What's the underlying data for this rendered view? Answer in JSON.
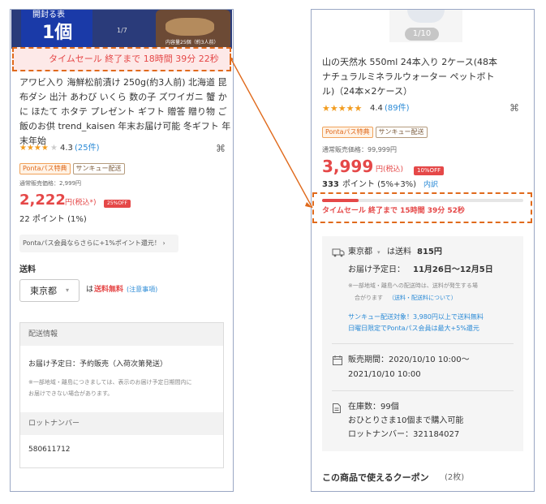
{
  "left": {
    "hero": {
      "badge_top": "開封る表",
      "badge_main": "1個",
      "counter": "1/7",
      "caption": "内容量25個（約3人前）"
    },
    "timesale": "タイムセール 終了まで 18時間 39分 22秒",
    "title_lines": [
      "アワビ入り 海鮮松前漬け 250g(約3人前) 北海道 昆",
      "布ダシ 出汁 あわび いくら 数の子 ズワイガニ 蟹 か",
      "に ほたて ホタテ プレゼント ギフト 贈答 贈り物 ご",
      "飯のお供 trend_kaisen 年末お届け可能 冬ギフト 年",
      "末年始"
    ],
    "rating": {
      "stars": "★★★★",
      "star_empty": "★",
      "value": "4.3",
      "count": "(25件)",
      "fraction": 0.86
    },
    "badges": [
      "Pontaパス特典",
      "サンキュー配送"
    ],
    "regular_price": "通常販売価格：2,999円",
    "price": "2,222",
    "price_unit": "円(税込*)",
    "off": "25%OFF",
    "points": "22 ポイント (1%)",
    "ponta_banner": "Pontaパス会員ならさらに+1%ポイント還元！ ›",
    "shipping_label": "送料",
    "pref": "東京都",
    "pref_arrow": "▾",
    "ship_prefix": "は",
    "ship_free": "送料無料",
    "ship_note": "(注意事項)",
    "info_header": "配送情報",
    "delivery": "お届け予定日：予約販売（入荷次第発送）",
    "delivery_note_1": "※一部地域・離島につきましては、表示のお届け予定日期間内に",
    "delivery_note_2": "お届けできない場合があります。",
    "lot_header": "ロットナンバー",
    "lot": "580611712"
  },
  "right": {
    "counter": "1/10",
    "title_lines": [
      "山の天然水 550ml 24本入り 2ケース(48本",
      "ナチュラルミネラルウォーター ペットボト",
      "ル)（24本×2ケース）"
    ],
    "rating": {
      "stars": "★★★★★",
      "value": "4.4",
      "count": "(89件)",
      "fraction": 0.88
    },
    "badges": [
      "Pontaパス特典",
      "サンキュー配送"
    ],
    "regular_price": "通常販売価格：99,999円",
    "price": "3,999",
    "price_unit": "円(税込)",
    "off": "10%OFF",
    "points_num": "333",
    "points_rest": "ポイント (5%+3%)",
    "points_link": "内訳",
    "timesale": "タイムセール 終了まで 15時間 39分 52秒",
    "progress": 0.18,
    "pref": "東京都",
    "pref_arrow": "▾",
    "ship_text": "は送料",
    "ship_fee": "815円",
    "delivery_label": "お届け予定日：",
    "delivery_dates": "11月26日〜12月5日",
    "delivery_note_1": "※一部地域・離島への配送時は、送料が発生する場",
    "delivery_note_2": "合がります",
    "delivery_note_link": "（送料・配送料について）",
    "sankyu_1": "サンキュー配送対象！3,980円以上で送料無料",
    "sankyu_2": "日曜日限定でPontaパス会員は最大+5%還元",
    "sale_period_1": "販売期間：2020/10/10 10:00〜",
    "sale_period_2": "2021/10/10 10:00",
    "stock": "在庫数：99個",
    "limit": "おひとりさま10個まで購入可能",
    "lot": "ロットナンバー：321184027",
    "coupon_title": "この商品で使えるクーポン",
    "coupon_count": "(2枚)"
  },
  "colors": {
    "accent_red": "#e54848",
    "dash_orange": "#e06a1c",
    "link_blue": "#2a8ad6"
  },
  "icons": [
    "share-icon",
    "truck-icon",
    "calendar-icon",
    "document-icon",
    "chevron-down-icon"
  ]
}
